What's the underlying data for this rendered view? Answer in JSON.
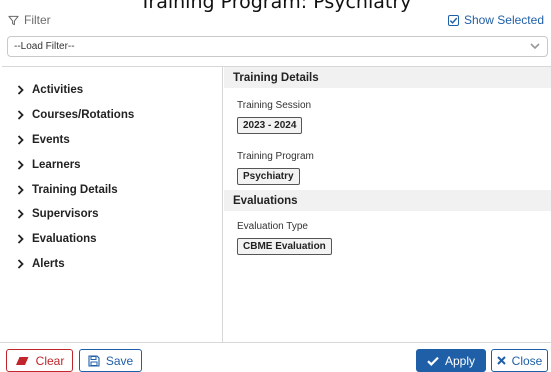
{
  "page_title": "Training Program: Psychiatry",
  "filter_header": {
    "label": "Filter",
    "show_selected_label": "Show Selected",
    "show_selected_checked": true
  },
  "load_filter": {
    "value": "--Load Filter--"
  },
  "nav": {
    "items": [
      {
        "label": "Activities"
      },
      {
        "label": "Courses/Rotations"
      },
      {
        "label": "Events"
      },
      {
        "label": "Learners"
      },
      {
        "label": "Training Details"
      },
      {
        "label": "Supervisors"
      },
      {
        "label": "Evaluations"
      },
      {
        "label": "Alerts"
      }
    ]
  },
  "details": {
    "training_details": {
      "title": "Training Details",
      "session_label": "Training Session",
      "session_value": "2023 - 2024",
      "program_label": "Training Program",
      "program_value": "Psychiatry"
    },
    "evaluations": {
      "title": "Evaluations",
      "type_label": "Evaluation Type",
      "type_value": "CBME Evaluation"
    }
  },
  "footer": {
    "clear_label": "Clear",
    "save_label": "Save",
    "apply_label": "Apply",
    "close_label": "Close"
  },
  "colors": {
    "primary": "#1f5fa8",
    "danger": "#c0262b",
    "section_bg": "#f1f1f1",
    "border": "#d7d7d7"
  },
  "icons": {
    "filter": "funnel-icon",
    "show_selected": "checkbox-checked-icon",
    "dropdown": "chevron-down-icon",
    "nav_item": "chevron-right-icon",
    "clear": "eraser-icon",
    "save": "floppy-disk-icon",
    "apply": "checkmark-icon",
    "close": "x-icon"
  }
}
